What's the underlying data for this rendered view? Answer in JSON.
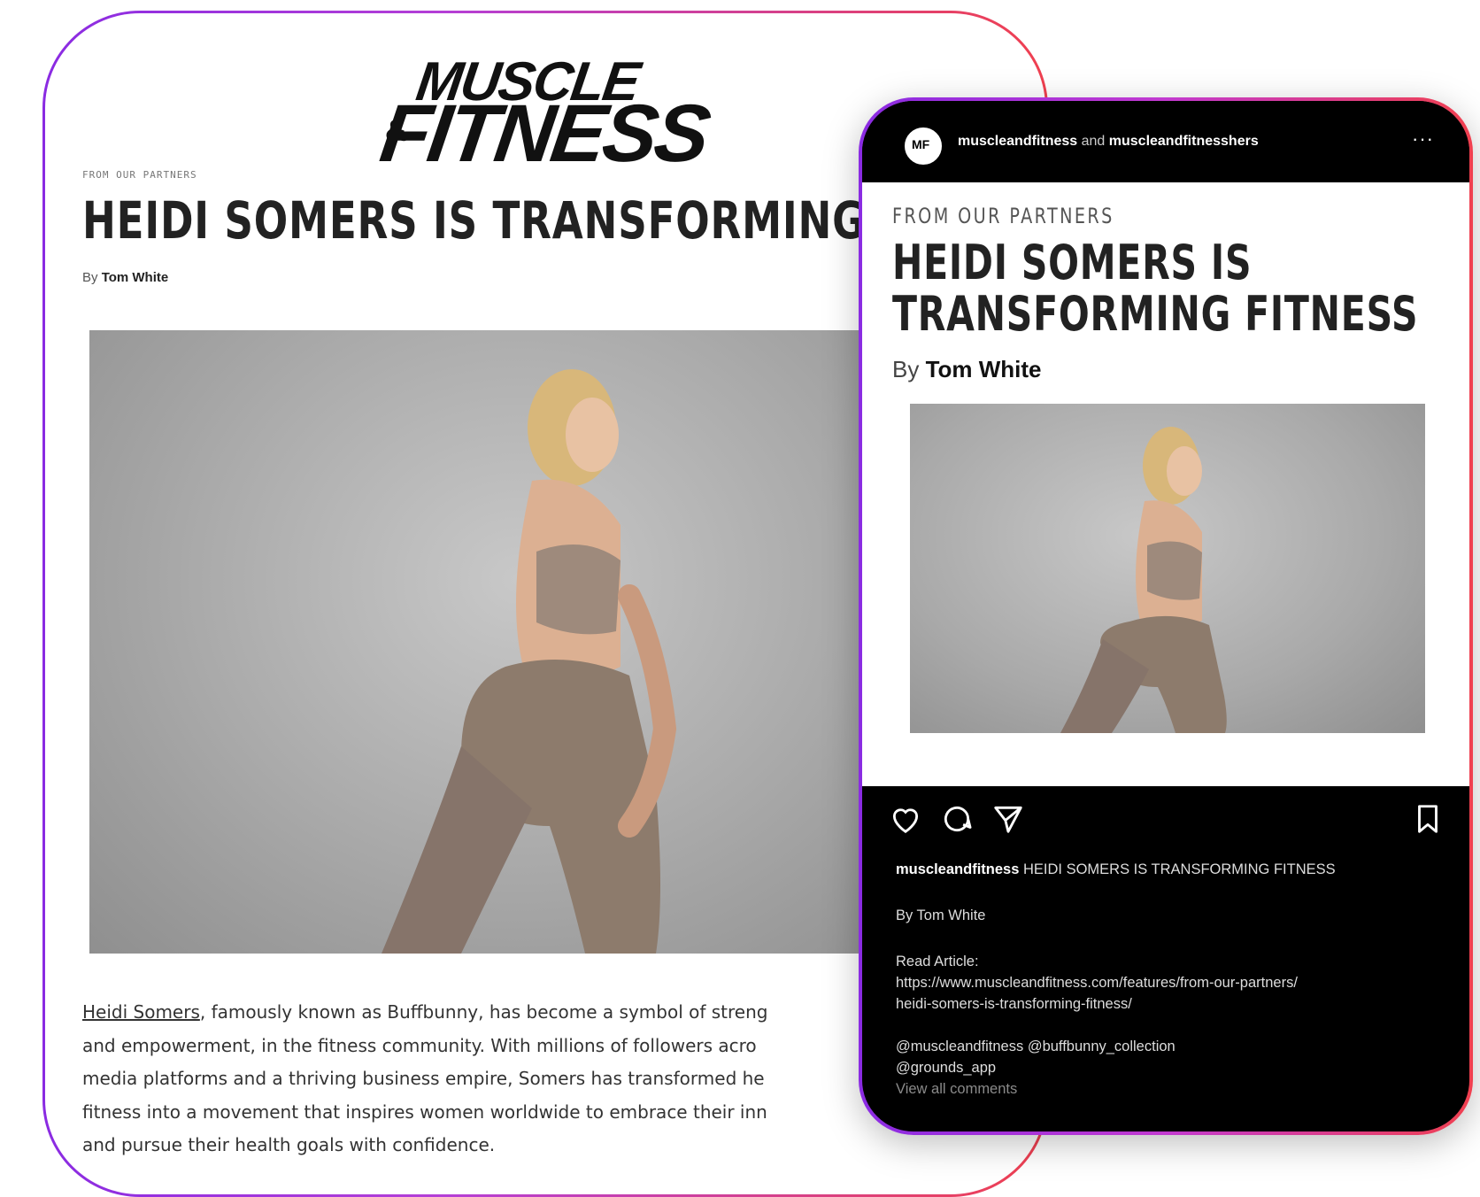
{
  "article": {
    "logo_line1": "MUSCLE",
    "logo_amp": "&",
    "logo_line2": "FITNESS",
    "kicker": "FROM OUR PARTNERS",
    "headline": "HEIDI SOMERS IS TRANSFORMING FIT",
    "by": "By",
    "author": "Tom White",
    "body": {
      "link": "Heidi Somers",
      "line1_rest": ", famously known as Buffbunny, has become a symbol of streng",
      "line2": "and empowerment, in the fitness community. With millions of followers acro",
      "line3": "media platforms and a thriving business empire, Somers has transformed he",
      "line4": "fitness into a movement that inspires women worldwide to embrace their inn",
      "line5": "and pursue their health goals with confidence."
    }
  },
  "instagram": {
    "avatar_text": "MF",
    "handle1": "muscleandfitness",
    "and_word": "and",
    "handle2": "muscleandfitnesshers",
    "more": "···",
    "post": {
      "kicker": "FROM OUR PARTNERS",
      "headline_line1": "HEIDI SOMERS IS",
      "headline_line2": "TRANSFORMING FITNESS",
      "by": "By",
      "author": "Tom White"
    },
    "caption": {
      "user": "muscleandfitness",
      "title": "HEIDI SOMERS IS TRANSFORMING FITNESS",
      "byline": "By Tom White",
      "read_label": "Read Article:",
      "url_line1": "https://www.muscleandfitness.com/features/from-our-partners/",
      "url_line2": "heidi-somers-is-transforming-fitness/",
      "tags_line1": "@muscleandfitness @buffbunny_collection",
      "tags_line2": "@grounds_app",
      "view_comments": "View all comments"
    },
    "icons": [
      "heart-icon",
      "comment-icon",
      "share-icon",
      "bookmark-icon"
    ]
  },
  "colors": {
    "gradient_start": "#8a2be2",
    "gradient_end": "#f0404f"
  }
}
